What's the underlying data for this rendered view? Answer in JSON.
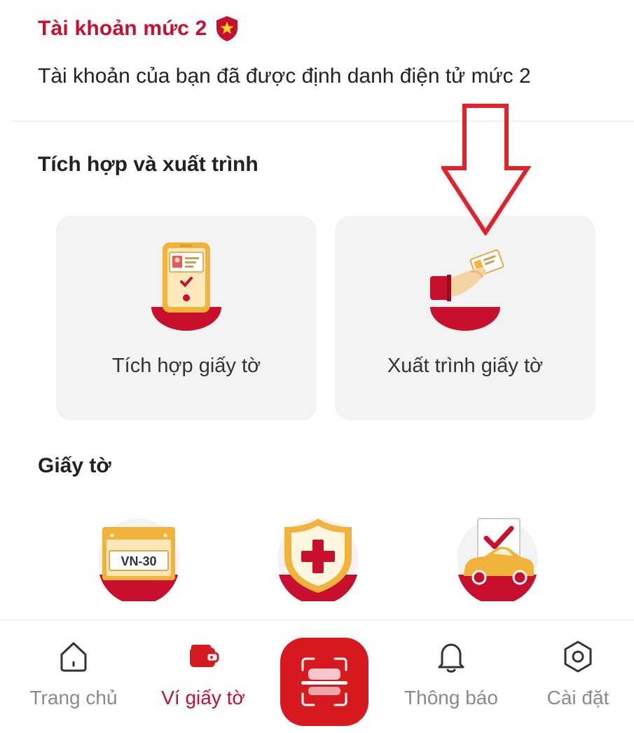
{
  "account": {
    "title": "Tài khoản mức 2",
    "description": "Tài khoản của bạn đã được định danh điện tử mức 2",
    "badge_icon": "star-shield-icon"
  },
  "integration_section": {
    "title": "Tích hợp và xuất trình",
    "cards": [
      {
        "label": "Tích hợp giấy tờ",
        "icon": "phone-id-card-icon"
      },
      {
        "label": "Xuất trình giấy tờ",
        "icon": "hand-card-icon"
      }
    ]
  },
  "documents_section": {
    "title": "Giấy tờ",
    "items": [
      {
        "icon": "license-plate-icon",
        "plate_text": "VN-30"
      },
      {
        "icon": "health-insurance-icon"
      },
      {
        "icon": "vehicle-registration-icon"
      }
    ]
  },
  "bottom_nav": {
    "items": [
      {
        "label": "Trang chủ",
        "icon": "home-icon"
      },
      {
        "label": "Ví giấy tờ",
        "icon": "wallet-icon",
        "active": true
      },
      {
        "label": "",
        "icon": "scan-icon"
      },
      {
        "label": "Thông báo",
        "icon": "bell-icon"
      },
      {
        "label": "Cài đặt",
        "icon": "settings-icon"
      }
    ]
  },
  "colors": {
    "brand_red": "#c8102e",
    "card_bg": "#f3f3f3",
    "inactive_gray": "#8a8a8a",
    "gold": "#f2b33d"
  }
}
